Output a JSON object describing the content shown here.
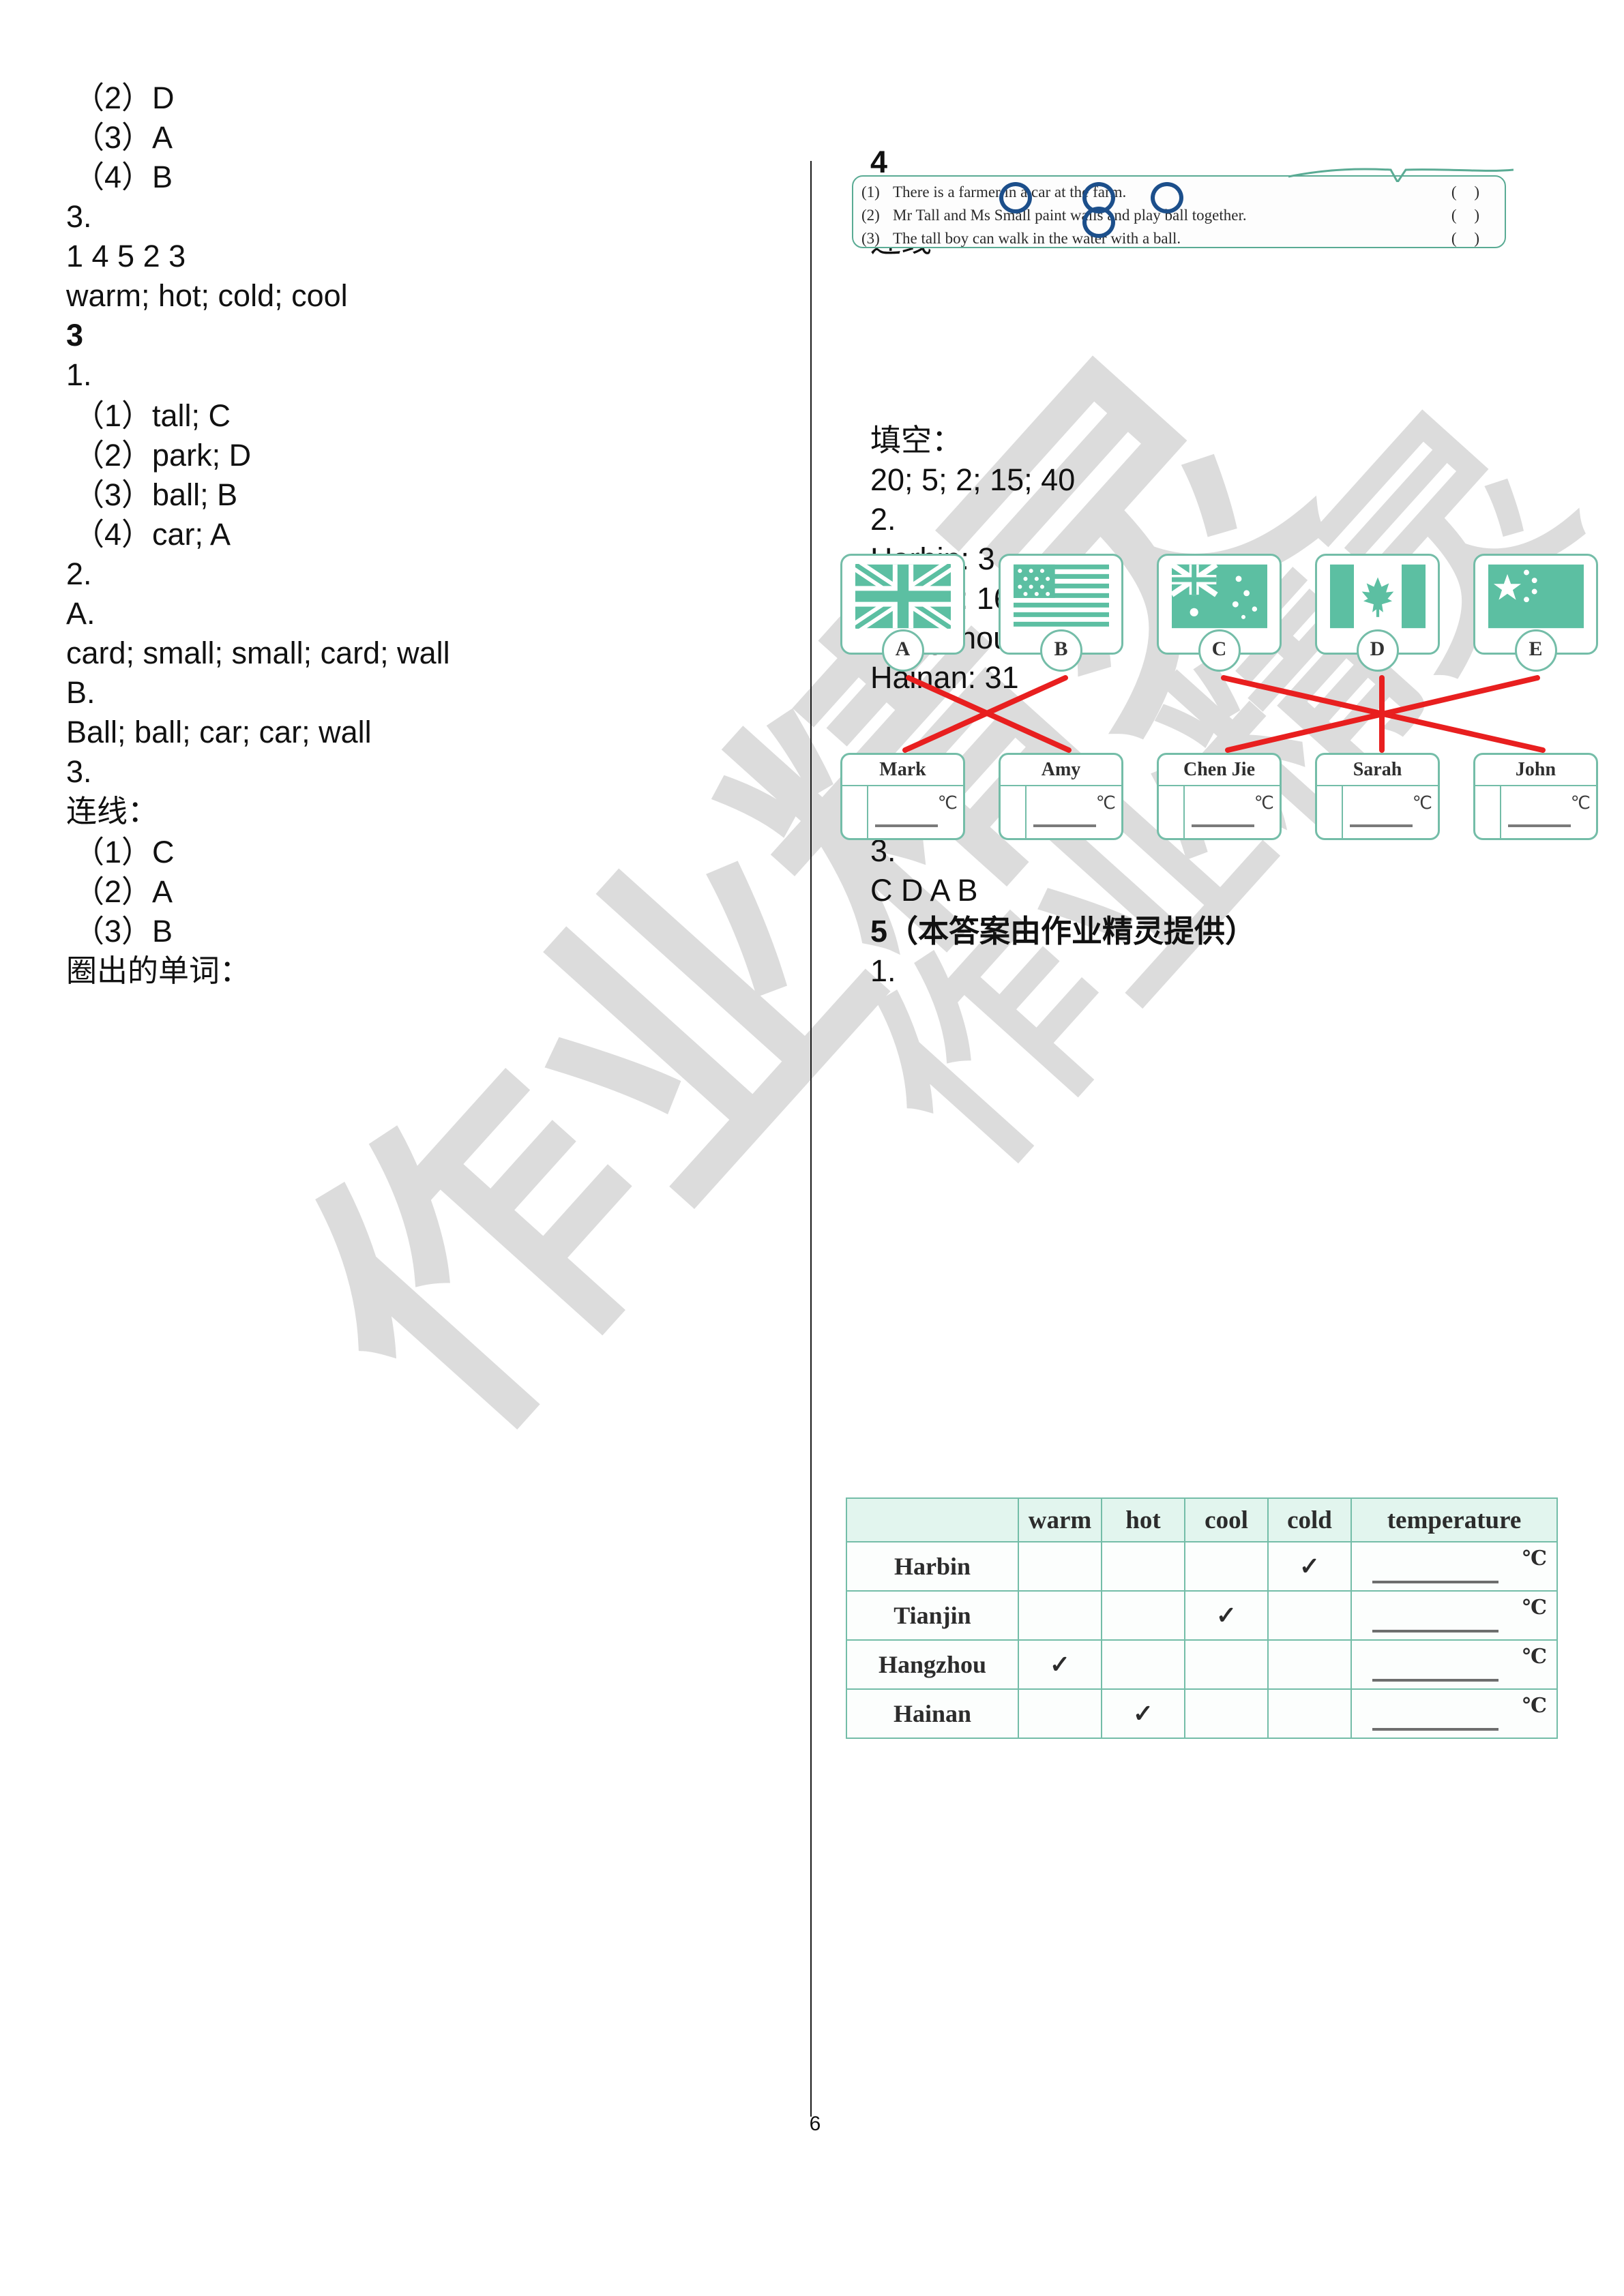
{
  "page": {
    "number": "6"
  },
  "watermark": {
    "text_a": "作业精灵",
    "text_b": "作业精灵"
  },
  "left_column": {
    "lines": [
      {
        "text": "（2）D",
        "indent": true,
        "bold": false
      },
      {
        "text": "（3）A",
        "indent": true,
        "bold": false
      },
      {
        "text": "（4）B",
        "indent": true,
        "bold": false
      },
      {
        "text": "3.",
        "indent": false,
        "bold": false
      },
      {
        "text": "1 4 5 2 3",
        "indent": false,
        "bold": false
      },
      {
        "text": "warm; hot; cold; cool",
        "indent": false,
        "bold": false
      },
      {
        "text": "3",
        "indent": false,
        "bold": true
      },
      {
        "text": "1.",
        "indent": false,
        "bold": false
      },
      {
        "text": "（1）tall; C",
        "indent": true,
        "bold": false
      },
      {
        "text": "（2）park; D",
        "indent": true,
        "bold": false
      },
      {
        "text": "（3）ball; B",
        "indent": true,
        "bold": false
      },
      {
        "text": "（4）car; A",
        "indent": true,
        "bold": false
      },
      {
        "text": "2.",
        "indent": false,
        "bold": false
      },
      {
        "text": "A.",
        "indent": false,
        "bold": false
      },
      {
        "text": "card; small; small; card; wall",
        "indent": false,
        "bold": false
      },
      {
        "text": "B.",
        "indent": false,
        "bold": false
      },
      {
        "text": "Ball; ball; car; car; wall",
        "indent": false,
        "bold": false
      },
      {
        "text": "3.",
        "indent": false,
        "bold": false
      },
      {
        "text": "连线：",
        "indent": false,
        "bold": false
      },
      {
        "text": "（1）C",
        "indent": true,
        "bold": false
      },
      {
        "text": "（2）A",
        "indent": true,
        "bold": false
      },
      {
        "text": "（3）B",
        "indent": true,
        "bold": false
      },
      {
        "text": "圈出的单词：",
        "indent": false,
        "bold": false
      }
    ]
  },
  "right_column": {
    "lines": [
      {
        "text": "4",
        "bold": true
      },
      {
        "text": "1.",
        "bold": false
      },
      {
        "text": "连线",
        "bold": false
      },
      {
        "text": "填空：",
        "bold": false
      },
      {
        "text": "20; 5; 2; 15; 40",
        "bold": false
      },
      {
        "text": "2.",
        "bold": false
      },
      {
        "text": "Harbin: 3",
        "bold": false
      },
      {
        "text": "Tianjin: 16",
        "bold": false
      },
      {
        "text": "Hangzhou: 23",
        "bold": false
      },
      {
        "text": "Hainan: 31",
        "bold": false
      },
      {
        "text": "3.",
        "bold": false
      },
      {
        "text": "C D A B",
        "bold": false
      },
      {
        "text": "5（本答案由作业精灵提供）",
        "bold": true
      },
      {
        "text": "1.",
        "bold": false
      }
    ]
  },
  "sentences_figure": {
    "rows": [
      {
        "num": "(1)",
        "text": "There is a farmer in a car at the farm.",
        "mark": "(  )"
      },
      {
        "num": "(2)",
        "text": "Mr Tall and Ms Small paint walls and play ball together.",
        "mark": "(  )"
      },
      {
        "num": "(3)",
        "text": "The tall boy can walk in the water with a ball.",
        "mark": "(  )"
      }
    ],
    "circled_words": [
      "far",
      "car",
      "far",
      "ai"
    ],
    "border_color": "#5aab94",
    "circle_color": "#1c4f8b"
  },
  "flags_figure": {
    "flags": [
      {
        "letter": "A",
        "country": "united-kingdom-flag"
      },
      {
        "letter": "B",
        "country": "united-states-flag"
      },
      {
        "letter": "C",
        "country": "australia-flag"
      },
      {
        "letter": "D",
        "country": "canada-flag"
      },
      {
        "letter": "E",
        "country": "china-flag"
      }
    ],
    "names": [
      "Mark",
      "Amy",
      "Chen Jie",
      "Sarah",
      "John"
    ],
    "unit": "℃",
    "matches": [
      {
        "from": "A",
        "to": "Amy"
      },
      {
        "from": "B",
        "to": "Mark"
      },
      {
        "from": "C",
        "to": "John"
      },
      {
        "from": "D",
        "to": "Sarah"
      },
      {
        "from": "E",
        "to": "Chen Jie"
      }
    ],
    "line_color": "#e81f1f",
    "border_color": "#74bda8"
  },
  "weather_table": {
    "columns": [
      "",
      "warm",
      "hot",
      "cool",
      "cold",
      "temperature"
    ],
    "rows": [
      {
        "city": "Harbin",
        "warm": "",
        "hot": "",
        "cool": "",
        "cold": "✓",
        "temperature": "℃"
      },
      {
        "city": "Tianjin",
        "warm": "",
        "hot": "",
        "cool": "✓",
        "cold": "",
        "temperature": "℃"
      },
      {
        "city": "Hangzhou",
        "warm": "✓",
        "hot": "",
        "cool": "",
        "cold": "",
        "temperature": "℃"
      },
      {
        "city": "Hainan",
        "warm": "",
        "hot": "✓",
        "cool": "",
        "cold": "",
        "temperature": "℃"
      }
    ],
    "header_bg": "#e2f5ee",
    "border_color": "#74bda8"
  }
}
